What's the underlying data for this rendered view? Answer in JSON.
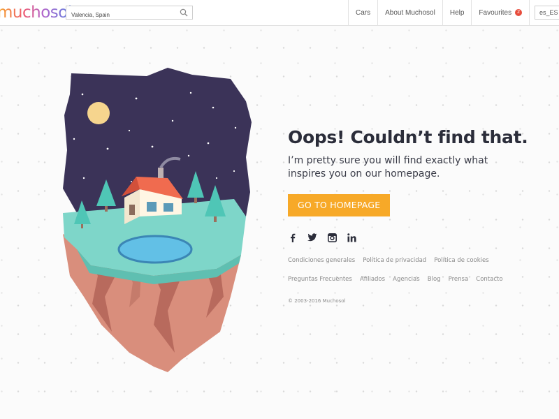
{
  "header": {
    "logo": "muchosol",
    "search": {
      "value": "Valencia, Spain",
      "icon": "search-icon"
    },
    "nav": [
      {
        "label": "Cars"
      },
      {
        "label": "About Muchosol"
      },
      {
        "label": "Help"
      },
      {
        "label": "Favourites",
        "badge": "2"
      }
    ],
    "language": "es_ES"
  },
  "main": {
    "title": "Oops! Couldn’t find that.",
    "subtitle": "I’m pretty sure you will find exactly what inspires you on our homepage.",
    "cta_label": "GO TO HOMEPAGE",
    "social": [
      "facebook-icon",
      "twitter-icon",
      "instagram-icon",
      "linkedin-icon"
    ],
    "footer_links": [
      "Condiciones generales",
      "Política de privacidad",
      "Política de cookies",
      "Preguntas Frecuentes",
      "Afiliados",
      "Agencias",
      "Blog",
      "Prensa",
      "Contacto"
    ],
    "copyright": "© 2003-2016 Muchosol"
  },
  "colors": {
    "accent": "#f7a928",
    "badge": "#e74c3c",
    "night_sky": "#3b3358",
    "grass": "#7ed6c9",
    "rock": "#d98e7c"
  }
}
